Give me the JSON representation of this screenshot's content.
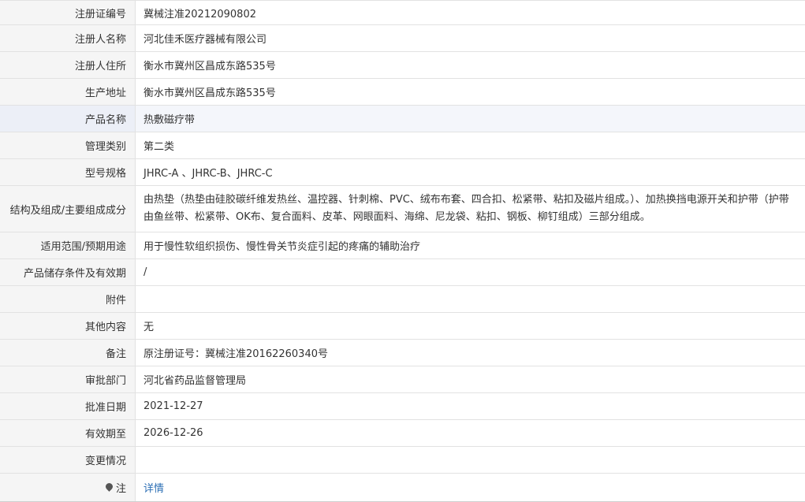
{
  "rows": [
    {
      "label": "注册证编号",
      "value": "冀械注准20212090802"
    },
    {
      "label": "注册人名称",
      "value": "河北佳禾医疗器械有限公司"
    },
    {
      "label": "注册人住所",
      "value": "衡水市冀州区昌成东路535号"
    },
    {
      "label": "生产地址",
      "value": "衡水市冀州区昌成东路535号"
    },
    {
      "label": "产品名称",
      "value": "热敷磁疗带"
    },
    {
      "label": "管理类别",
      "value": "第二类"
    },
    {
      "label": "型号规格",
      "value": "JHRC-A 、JHRC-B、JHRC-C"
    },
    {
      "label": "结构及组成/主要组成成分",
      "value": "由热垫（热垫由硅胶碳纤维发热丝、温控器、针刺棉、PVC、绒布布套、四合扣、松紧带、粘扣及磁片组成。）、加热换挡电源开关和护带（护带由鱼丝带、松紧带、OK布、复合面料、皮革、网眼面料、海绵、尼龙袋、粘扣、钢板、柳钉组成）三部分组成。"
    },
    {
      "label": "适用范围/预期用途",
      "value": "用于慢性软组织损伤、慢性骨关节炎症引起的疼痛的辅助治疗"
    },
    {
      "label": "产品储存条件及有效期",
      "value": "/"
    },
    {
      "label": "附件",
      "value": ""
    },
    {
      "label": "其他内容",
      "value": "无"
    },
    {
      "label": "备注",
      "value": "原注册证号：冀械注准20162260340号"
    },
    {
      "label": "审批部门",
      "value": "河北省药品监督管理局"
    },
    {
      "label": "批准日期",
      "value": "2021-12-27"
    },
    {
      "label": "有效期至",
      "value": "2026-12-26"
    },
    {
      "label": "变更情况",
      "value": ""
    }
  ],
  "note": {
    "label": "注",
    "icon": "location-pin-icon",
    "link_text": "详情",
    "link_color": "#2c6fb5"
  }
}
